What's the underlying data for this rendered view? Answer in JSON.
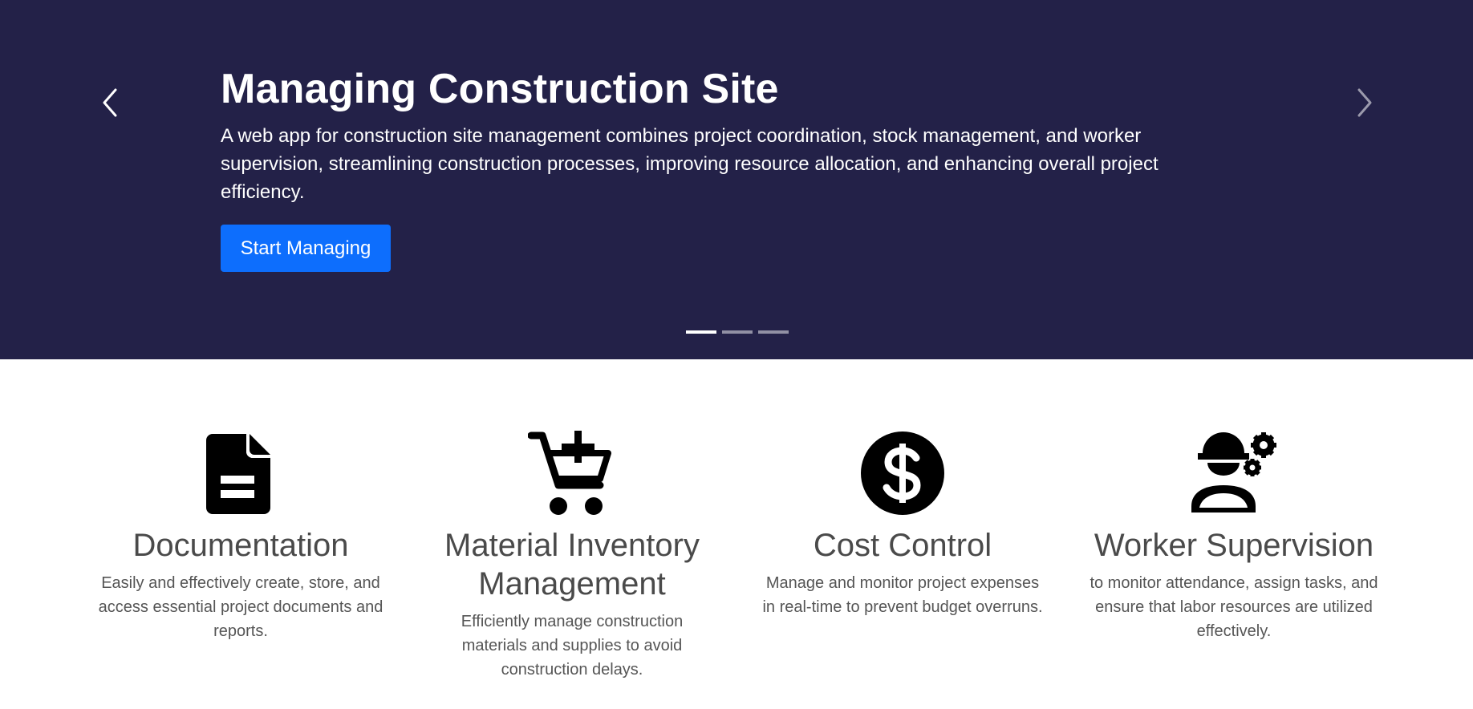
{
  "hero": {
    "title": "Managing Construction Site",
    "description": "A web app for construction site management combines project coordination, stock management, and worker supervision, streamlining construction processes, improving resource allocation, and enhancing overall project efficiency.",
    "button_label": "Start Managing",
    "background_color": "#232148",
    "button_color": "#0d6efd",
    "slide_count": 3,
    "active_slide": 1,
    "prev_icon": "chevron-left-icon",
    "next_icon": "chevron-right-icon"
  },
  "features": [
    {
      "icon": "file-document-icon",
      "title": "Documentation",
      "text": "Easily and effectively create, store, and access essential project documents and reports."
    },
    {
      "icon": "cart-plus-icon",
      "title": "Material Inventory Management",
      "text": "Efficiently manage construction materials and supplies to avoid construction delays."
    },
    {
      "icon": "dollar-circle-icon",
      "title": "Cost Control",
      "text": "Manage and monitor project expenses in real-time to prevent budget overruns."
    },
    {
      "icon": "worker-gears-icon",
      "title": "Worker Supervision",
      "text": "to monitor attendance, assign tasks, and ensure that labor resources are utilized effectively."
    }
  ]
}
